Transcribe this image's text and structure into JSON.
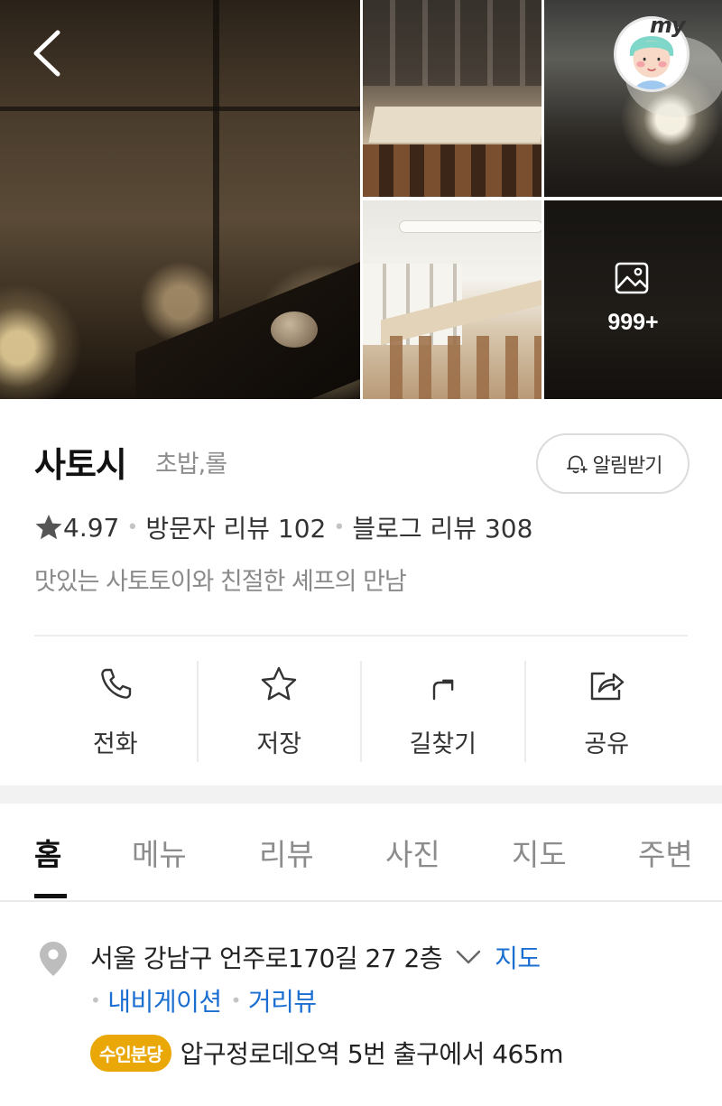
{
  "photos": {
    "more_count": "999+"
  },
  "header": {
    "my_label": "my"
  },
  "place": {
    "name": "사토시",
    "category": "초밥,롤",
    "alarm_label": "알림받기",
    "rating": "4.97",
    "visitor_review": "방문자 리뷰 102",
    "blog_review": "블로그 리뷰 308",
    "tagline": "맛있는 사토토이와 친절한 셰프의 만남"
  },
  "actions": [
    {
      "label": "전화",
      "icon": "phone-icon"
    },
    {
      "label": "저장",
      "icon": "star-icon"
    },
    {
      "label": "길찾기",
      "icon": "directions-icon"
    },
    {
      "label": "공유",
      "icon": "share-icon"
    }
  ],
  "tabs": [
    {
      "label": "홈",
      "active": true
    },
    {
      "label": "메뉴"
    },
    {
      "label": "리뷰"
    },
    {
      "label": "사진"
    },
    {
      "label": "지도"
    },
    {
      "label": "주변"
    }
  ],
  "address": {
    "text": "서울 강남구 언주로170길 27 2층",
    "map_link": "지도",
    "navigation_link": "내비게이션",
    "street_view_link": "거리뷰",
    "subway_line": "수인분당",
    "subway_text": "압구정로데오역 5번 출구에서 465m"
  },
  "colors": {
    "link": "#1a6fd1",
    "subway_badge": "#e9a807"
  }
}
